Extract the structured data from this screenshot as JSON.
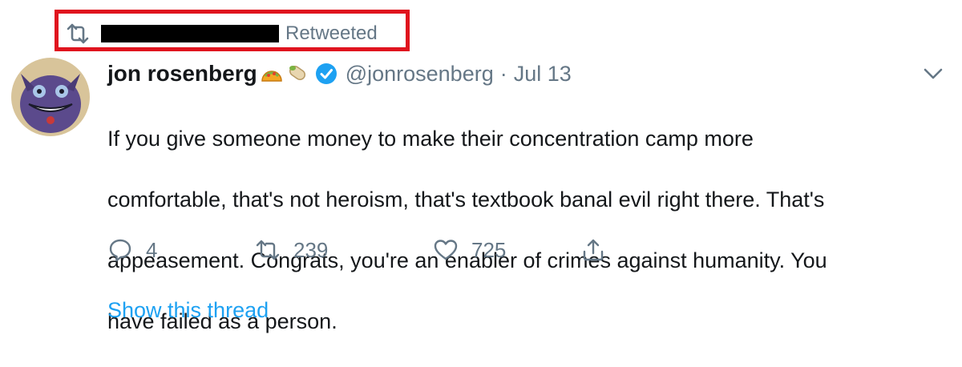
{
  "retweet_banner": {
    "label": "Retweeted",
    "icon": "retweet-icon",
    "highlight_color": "#e0141e",
    "redacted": true
  },
  "tweet": {
    "author": {
      "display_name": "jon rosenberg",
      "emojis": [
        "taco-emoji",
        "burrito-emoji"
      ],
      "verified": true,
      "handle": "@jonrosenberg"
    },
    "separator": "·",
    "date": "Jul 13",
    "text_lines": [
      "If you give someone money to make their concentration camp more",
      "comfortable, that's not heroism, that's textbook banal evil right there. That's",
      "appeasement. Congrats, you're an enabler of crimes against humanity. You",
      "have failed as a person."
    ],
    "actions": {
      "reply_count": "4",
      "retweet_count": "239",
      "like_count": "725"
    },
    "show_thread_label": "Show this thread"
  },
  "colors": {
    "text": "#14171a",
    "muted": "#657786",
    "link": "#1da1f2",
    "verified": "#1da1f2"
  }
}
